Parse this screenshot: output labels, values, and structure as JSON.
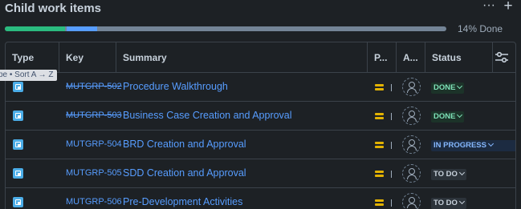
{
  "header": {
    "title": "Child work items",
    "more_label": "···",
    "add_label": "+"
  },
  "progress": {
    "label": "14% Done",
    "done_fraction": 0.14,
    "in_progress_fraction": 0.07
  },
  "table": {
    "columns": [
      "Type",
      "Key",
      "Summary",
      "P...",
      "A...",
      "Status"
    ],
    "settings_icon": "column-settings-icon",
    "tooltip": "pe • Sort A → Z",
    "rows": [
      {
        "type_icon": "subtask-icon",
        "key": "MUTGRP-502",
        "key_done": true,
        "summary": "Procedure Walkthrough",
        "priority_icon": "priority-medium-icon",
        "status": "DONE",
        "status_kind": "done"
      },
      {
        "type_icon": "subtask-icon",
        "key": "MUTGRP-503",
        "key_done": true,
        "summary": "Business Case Creation and Approval",
        "priority_icon": "priority-medium-icon",
        "status": "DONE",
        "status_kind": "done"
      },
      {
        "type_icon": "subtask-icon",
        "key": "MUTGRP-504",
        "key_done": false,
        "summary": "BRD Creation and Approval",
        "priority_icon": "priority-medium-icon",
        "status": "IN PROGRESS",
        "status_kind": "progress"
      },
      {
        "type_icon": "subtask-icon",
        "key": "MUTGRP-505",
        "key_done": false,
        "summary": "SDD Creation and Approval",
        "priority_icon": "priority-medium-icon",
        "status": "TO DO",
        "status_kind": "todo"
      },
      {
        "type_icon": "subtask-icon",
        "key": "MUTGRP-506",
        "key_done": false,
        "summary": "Pre-Development Activities",
        "priority_icon": "priority-medium-icon",
        "status": "TO DO",
        "status_kind": "todo"
      }
    ]
  },
  "colors": {
    "background": "#1d2125",
    "link": "#579dff",
    "done_segment": "#2abb7f",
    "progress_segment": "#579dff",
    "priority": "#e2b203"
  }
}
